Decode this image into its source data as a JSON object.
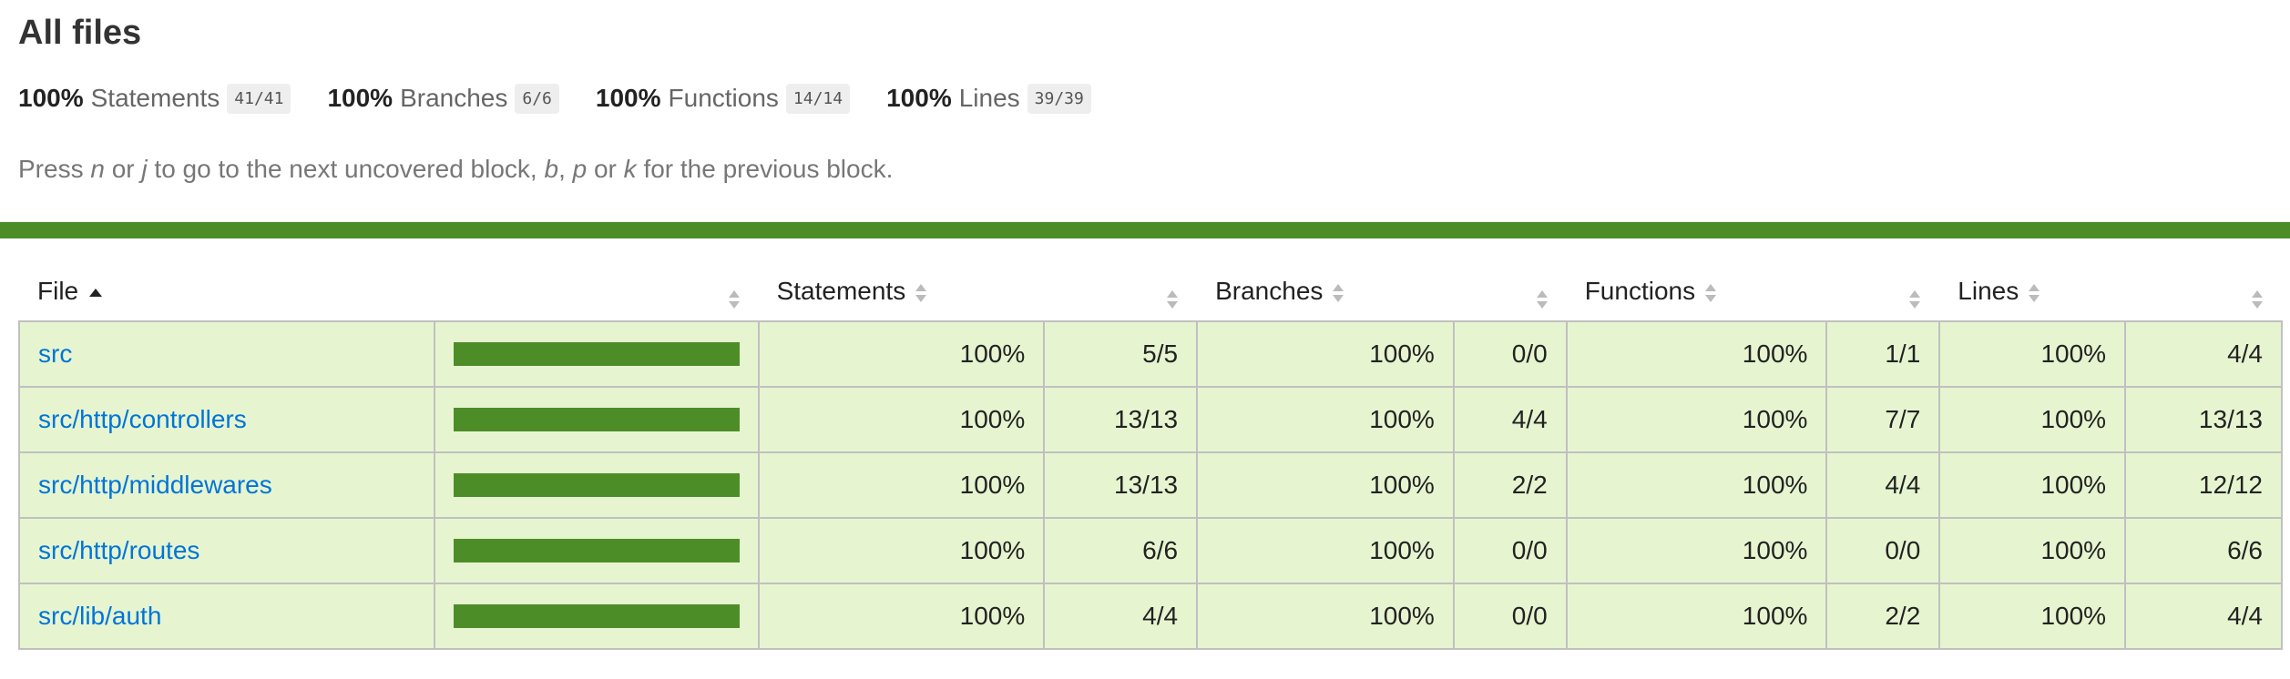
{
  "page": {
    "title": "All files",
    "hint_parts": [
      "Press ",
      "n",
      " or ",
      "j",
      " to go to the next uncovered block, ",
      "b",
      ", ",
      "p",
      " or ",
      "k",
      " for the previous block."
    ]
  },
  "summary": [
    {
      "pct": "100%",
      "label": "Statements",
      "fraction": "41/41"
    },
    {
      "pct": "100%",
      "label": "Branches",
      "fraction": "6/6"
    },
    {
      "pct": "100%",
      "label": "Functions",
      "fraction": "14/14"
    },
    {
      "pct": "100%",
      "label": "Lines",
      "fraction": "39/39"
    }
  ],
  "table": {
    "headers": {
      "file": "File",
      "statements": "Statements",
      "branches": "Branches",
      "functions": "Functions",
      "lines": "Lines"
    },
    "rows": [
      {
        "file": "src",
        "coverage": 1.0,
        "statements_pct": "100%",
        "statements": "5/5",
        "branches_pct": "100%",
        "branches": "0/0",
        "functions_pct": "100%",
        "functions": "1/1",
        "lines_pct": "100%",
        "lines": "4/4"
      },
      {
        "file": "src/http/controllers",
        "coverage": 1.0,
        "statements_pct": "100%",
        "statements": "13/13",
        "branches_pct": "100%",
        "branches": "4/4",
        "functions_pct": "100%",
        "functions": "7/7",
        "lines_pct": "100%",
        "lines": "13/13"
      },
      {
        "file": "src/http/middlewares",
        "coverage": 1.0,
        "statements_pct": "100%",
        "statements": "13/13",
        "branches_pct": "100%",
        "branches": "2/2",
        "functions_pct": "100%",
        "functions": "4/4",
        "lines_pct": "100%",
        "lines": "12/12"
      },
      {
        "file": "src/http/routes",
        "coverage": 1.0,
        "statements_pct": "100%",
        "statements": "6/6",
        "branches_pct": "100%",
        "branches": "0/0",
        "functions_pct": "100%",
        "functions": "0/0",
        "lines_pct": "100%",
        "lines": "6/6"
      },
      {
        "file": "src/lib/auth",
        "coverage": 1.0,
        "statements_pct": "100%",
        "statements": "4/4",
        "branches_pct": "100%",
        "branches": "0/0",
        "functions_pct": "100%",
        "functions": "2/2",
        "lines_pct": "100%",
        "lines": "4/4"
      }
    ]
  },
  "colors": {
    "status_bar": "#4d8d28",
    "row_background": "#e6f5d0",
    "link": "#0074d9"
  },
  "icons": {
    "sort_ascending": "sort-ascending-icon",
    "sort_unsorted": "sort-icon"
  }
}
